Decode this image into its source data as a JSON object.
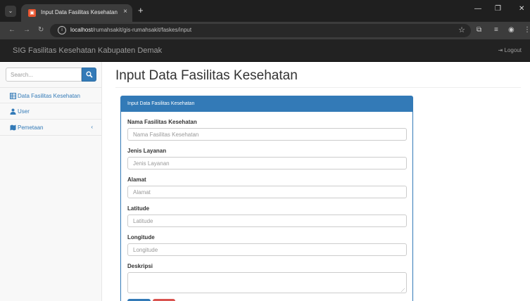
{
  "browser": {
    "tab_title": "Input Data Fasilitas Kesehatan",
    "tab_close": "×",
    "new_tab": "+",
    "url_host": "localhost",
    "url_path": "/rumahsakit/gis-rumahsakit/faskes/input"
  },
  "navbar": {
    "brand": "SIG Fasilitas Kesehatan Kabupaten Demak",
    "logout": "Logout"
  },
  "sidebar": {
    "search_placeholder": "Search...",
    "items": [
      {
        "label": "Data Fasilitas Kesehatan",
        "icon": "table-icon"
      },
      {
        "label": "User",
        "icon": "user-icon"
      },
      {
        "label": "Pemetaan",
        "icon": "map-icon",
        "caret": "‹"
      }
    ]
  },
  "main": {
    "title": "Input Data Fasilitas Kesehatan",
    "panel_heading": "Input Data Fasilitas Kesehatan",
    "fields": [
      {
        "label": "Nama Fasilitas Kesehatan",
        "placeholder": "Nama Fasilitas Kesehatan"
      },
      {
        "label": "Jenis Layanan",
        "placeholder": "Jenis Layanan"
      },
      {
        "label": "Alamat",
        "placeholder": "Alamat"
      },
      {
        "label": "Latitude",
        "placeholder": "Latitude"
      },
      {
        "label": "Longitude",
        "placeholder": "Longitude"
      },
      {
        "label": "Deskripsi",
        "placeholder": ""
      }
    ]
  },
  "colors": {
    "primary": "#337ab7",
    "danger": "#d9534f",
    "navbar": "#222222",
    "sidebar": "#f8f8f8"
  }
}
